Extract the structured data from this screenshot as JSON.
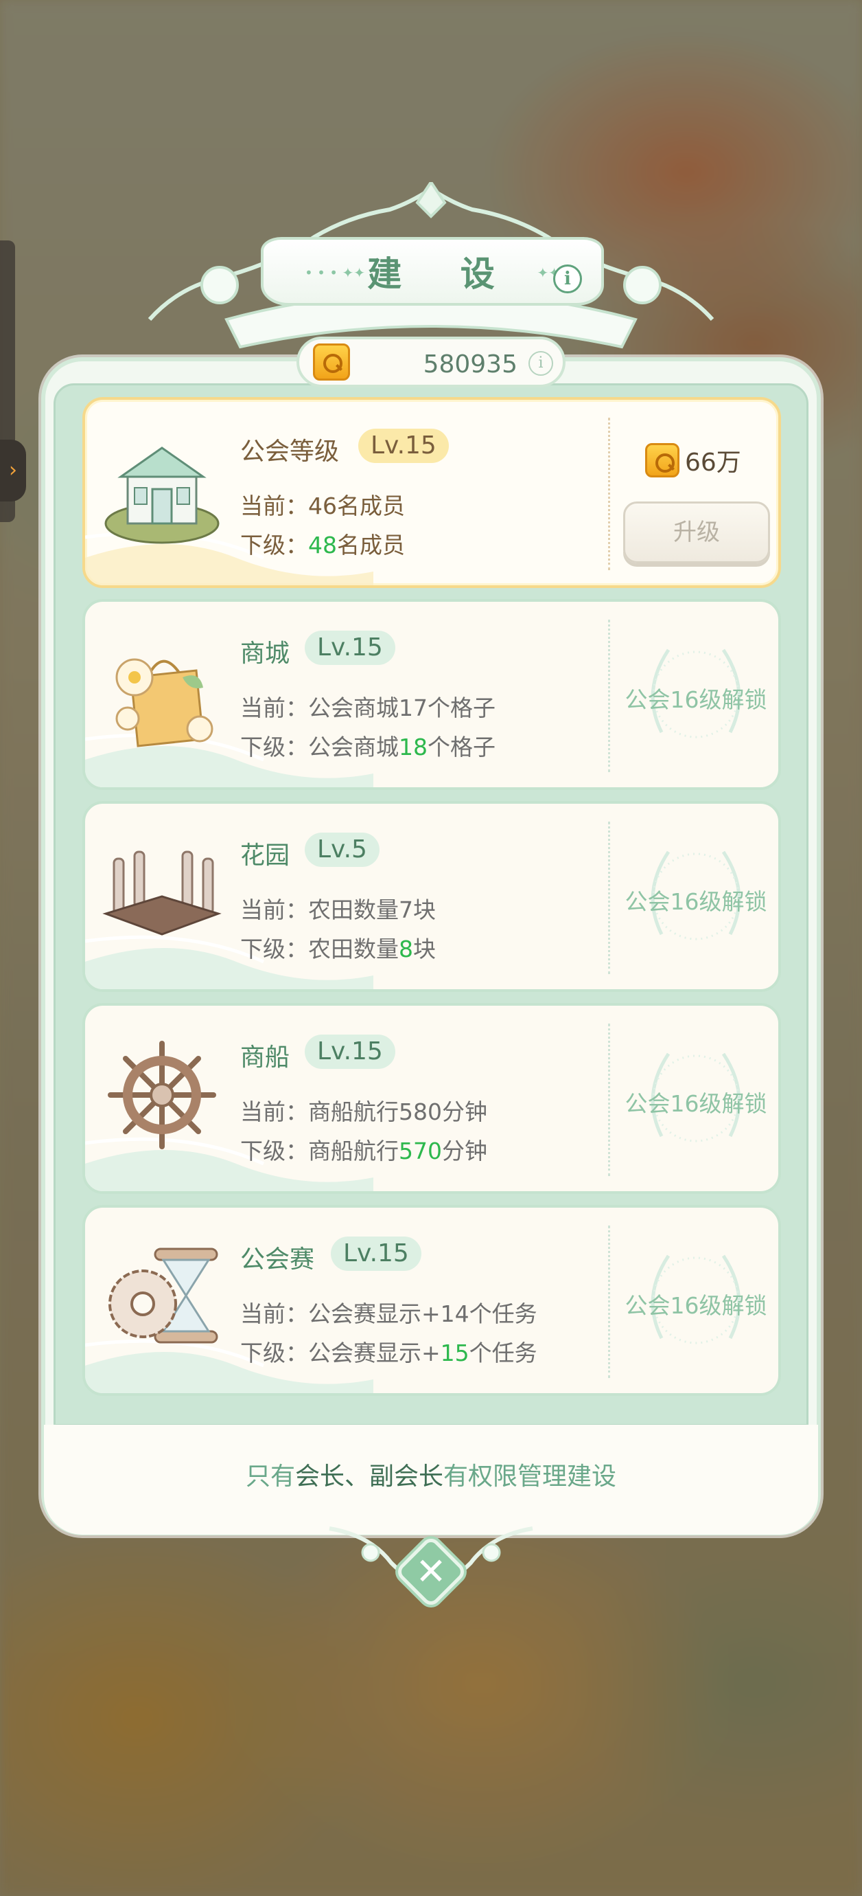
{
  "header": {
    "title": "建 设",
    "info_icon": "i"
  },
  "currency": {
    "value": "580935",
    "info_icon": "i"
  },
  "cards": [
    {
      "name": "公会等级",
      "level": "Lv.15",
      "current_prefix": "当前：",
      "current_value": "46名成员",
      "next_prefix": "下级：",
      "next_num": "48",
      "next_suffix": "名成员",
      "cost": "66万",
      "upgrade_label": "升级"
    },
    {
      "name": "商城",
      "level": "Lv.15",
      "current_prefix": "当前：",
      "current_value": "公会商城17个格子",
      "next_prefix": "下级：",
      "next_pre": "公会商城",
      "next_num": "18",
      "next_suffix": "个格子",
      "lock_text": "公会16级解锁"
    },
    {
      "name": "花园",
      "level": "Lv.5",
      "current_prefix": "当前：",
      "current_value": "农田数量7块",
      "next_prefix": "下级：",
      "next_pre": "农田数量",
      "next_num": "8",
      "next_suffix": "块",
      "lock_text": "公会16级解锁"
    },
    {
      "name": "商船",
      "level": "Lv.15",
      "current_prefix": "当前：",
      "current_value": "商船航行580分钟",
      "next_prefix": "下级：",
      "next_pre": "商船航行",
      "next_num": "570",
      "next_suffix": "分钟",
      "lock_text": "公会16级解锁"
    },
    {
      "name": "公会赛",
      "level": "Lv.15",
      "current_prefix": "当前：",
      "current_value": "公会赛显示+14个任务",
      "next_prefix": "下级：",
      "next_pre": "公会赛显示+",
      "next_num": "15",
      "next_suffix": "个任务",
      "lock_text": "公会16级解锁"
    }
  ],
  "footer": {
    "p1": "只有",
    "em1": "会长、副会长",
    "p2": "有权限管理建设"
  },
  "close_icon": "✕",
  "colors": {
    "accent_green": "#5a9473",
    "highlight_gold": "#f6d98b",
    "increase_green": "#2db84d"
  }
}
